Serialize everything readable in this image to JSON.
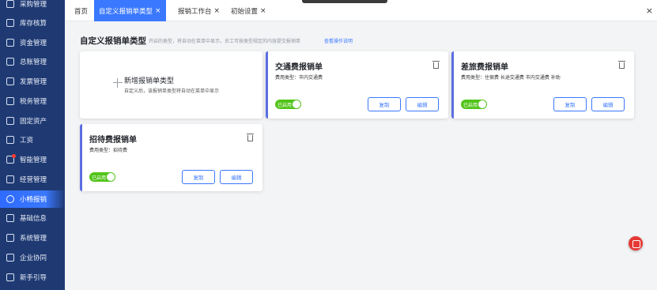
{
  "sidebar": {
    "items": [
      {
        "label": "采购管理"
      },
      {
        "label": "库存核算"
      },
      {
        "label": "资金管理"
      },
      {
        "label": "总账管理"
      },
      {
        "label": "发票管理"
      },
      {
        "label": "税务管理"
      },
      {
        "label": "固定资产"
      },
      {
        "label": "工资"
      },
      {
        "label": "智能管理"
      },
      {
        "label": "经营管理"
      },
      {
        "label": "小畅报销"
      },
      {
        "label": "基础信息"
      },
      {
        "label": "系统管理"
      },
      {
        "label": "企业协同"
      },
      {
        "label": "新手引导"
      }
    ],
    "active_index": 10
  },
  "tabs": [
    {
      "label": "首页"
    },
    {
      "label": "自定义报销单类型"
    },
    {
      "label": "报销工作台"
    },
    {
      "label": "初始设置"
    }
  ],
  "tab_close_symbol": "×",
  "page": {
    "title": "自定义报销单类型",
    "description": "开启的类型，将自动在菜单中显示，员工可按类型规定的内容提交报销单",
    "help_link": "查看操作说明"
  },
  "add_card": {
    "title": "新增报销单类型",
    "description": "自定义后，该报销单类型将自动在菜单中显示"
  },
  "cards": [
    {
      "title": "交通费报销单",
      "subtitle": "费用类型：市内交通费",
      "toggle_label": "已启用",
      "copy_label": "复制",
      "edit_label": "编辑"
    },
    {
      "title": "差旅费报销单",
      "subtitle": "费用类型：住宿费 长途交通费 市内交通费 补助",
      "toggle_label": "已启用",
      "copy_label": "复制",
      "edit_label": "编辑"
    },
    {
      "title": "招待费报销单",
      "subtitle": "费用类型：招待费",
      "toggle_label": "已启用",
      "copy_label": "复制",
      "edit_label": "编辑"
    }
  ],
  "colors": {
    "sidebar_bg": "#1f3a73",
    "accent": "#3a78ff",
    "toggle_on": "#52c41a",
    "card_border": "#5b6ee1",
    "help_button": "#e53935"
  }
}
